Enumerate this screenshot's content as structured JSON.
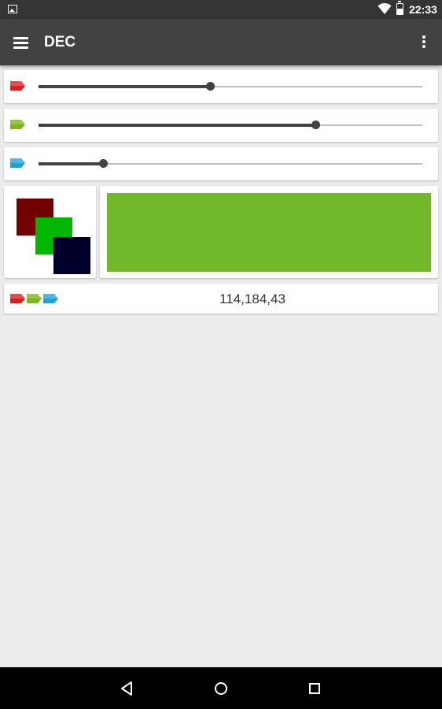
{
  "status_bar": {
    "time": "22:33",
    "icons": [
      "picture-icon",
      "wifi-icon",
      "battery-icon"
    ]
  },
  "app_bar": {
    "title": "DEC",
    "icons": [
      "menu-icon",
      "overflow-menu-icon"
    ]
  },
  "sliders": [
    {
      "channel": "red",
      "tag_color": "#e21b1b",
      "value": 114,
      "max": 255
    },
    {
      "channel": "green",
      "tag_color": "#7cb518",
      "value": 184,
      "max": 255
    },
    {
      "channel": "blue",
      "tag_color": "#1ea3d8",
      "value": 43,
      "max": 255
    }
  ],
  "swatch": {
    "colors": [
      "#720000",
      "#00b800",
      "#00002b"
    ]
  },
  "preview": {
    "color": "#72b82b"
  },
  "value_row": {
    "tag_colors": [
      "#e21b1b",
      "#7cb518",
      "#1ea3d8"
    ],
    "value": "114,184,43"
  },
  "nav_bar": {
    "icons": [
      "back-icon",
      "home-icon",
      "recents-icon"
    ]
  },
  "colors": {
    "background": "#ececec",
    "app_bar": "#424242",
    "status_bar": "#353535",
    "slider_active": "#424242",
    "slider_inactive": "#bdbdbd"
  }
}
